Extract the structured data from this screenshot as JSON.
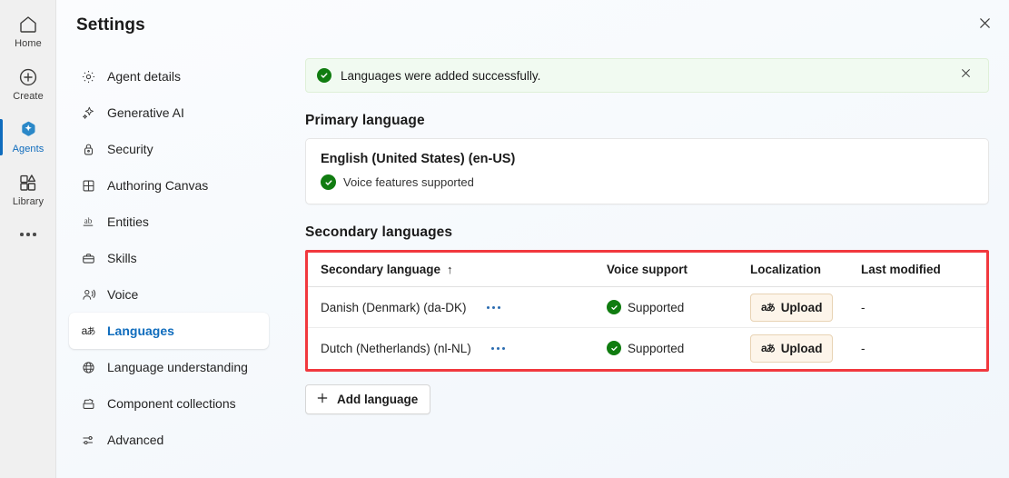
{
  "app_rail": {
    "items": [
      {
        "label": "Home",
        "icon": "home-icon",
        "selected": false
      },
      {
        "label": "Create",
        "icon": "plus-circle-icon",
        "selected": false
      },
      {
        "label": "Agents",
        "icon": "agents-sparkle-icon",
        "selected": true
      },
      {
        "label": "Library",
        "icon": "library-icon",
        "selected": false
      }
    ],
    "overflow_label": "More",
    "accent_color": "#0f6cbd"
  },
  "header": {
    "title": "Settings",
    "close_label": "Close",
    "close_icon": "close-icon"
  },
  "settings_nav": {
    "items": [
      {
        "label": "Agent details",
        "icon": "gear-icon",
        "selected": false
      },
      {
        "label": "Generative AI",
        "icon": "sparkle-icon",
        "selected": false
      },
      {
        "label": "Security",
        "icon": "lock-icon",
        "selected": false
      },
      {
        "label": "Authoring Canvas",
        "icon": "grid-icon",
        "selected": false
      },
      {
        "label": "Entities",
        "icon": "ab-underline-icon",
        "selected": false
      },
      {
        "label": "Skills",
        "icon": "briefcase-icon",
        "selected": false
      },
      {
        "label": "Voice",
        "icon": "voice-person-icon",
        "selected": false
      },
      {
        "label": "Languages",
        "icon": "translate-icon",
        "selected": true
      },
      {
        "label": "Language understanding",
        "icon": "globe-brain-icon",
        "selected": false
      },
      {
        "label": "Component collections",
        "icon": "collections-icon",
        "selected": false
      },
      {
        "label": "Advanced",
        "icon": "sliders-icon",
        "selected": false
      }
    ]
  },
  "banner": {
    "message": "Languages were added successfully.",
    "status_icon": "success-check-icon",
    "close_icon": "close-icon",
    "background_color": "#f1faf1",
    "icon_color": "#107c10"
  },
  "primary_language": {
    "heading": "Primary language",
    "name": "English (United States) (en-US)",
    "voice_note": "Voice features supported",
    "voice_icon": "success-check-icon"
  },
  "secondary_languages": {
    "heading": "Secondary languages",
    "highlight_color": "#f1383e",
    "columns": [
      {
        "label": "Secondary language",
        "sort": "↑"
      },
      {
        "label": "Voice support"
      },
      {
        "label": "Localization"
      },
      {
        "label": "Last modified"
      }
    ],
    "rows": [
      {
        "language": "Danish (Denmark) (da-DK)",
        "menu_icon": "more-horizontal-icon",
        "voice_support": "Supported",
        "voice_icon": "success-check-icon",
        "localization_label": "Upload",
        "localization_icon": "translate-icon",
        "last_modified": "-"
      },
      {
        "language": "Dutch (Netherlands) (nl-NL)",
        "menu_icon": "more-horizontal-icon",
        "voice_support": "Supported",
        "voice_icon": "success-check-icon",
        "localization_label": "Upload",
        "localization_icon": "translate-icon",
        "last_modified": "-"
      }
    ],
    "add_button": {
      "label": "Add language",
      "icon": "plus-icon"
    }
  }
}
